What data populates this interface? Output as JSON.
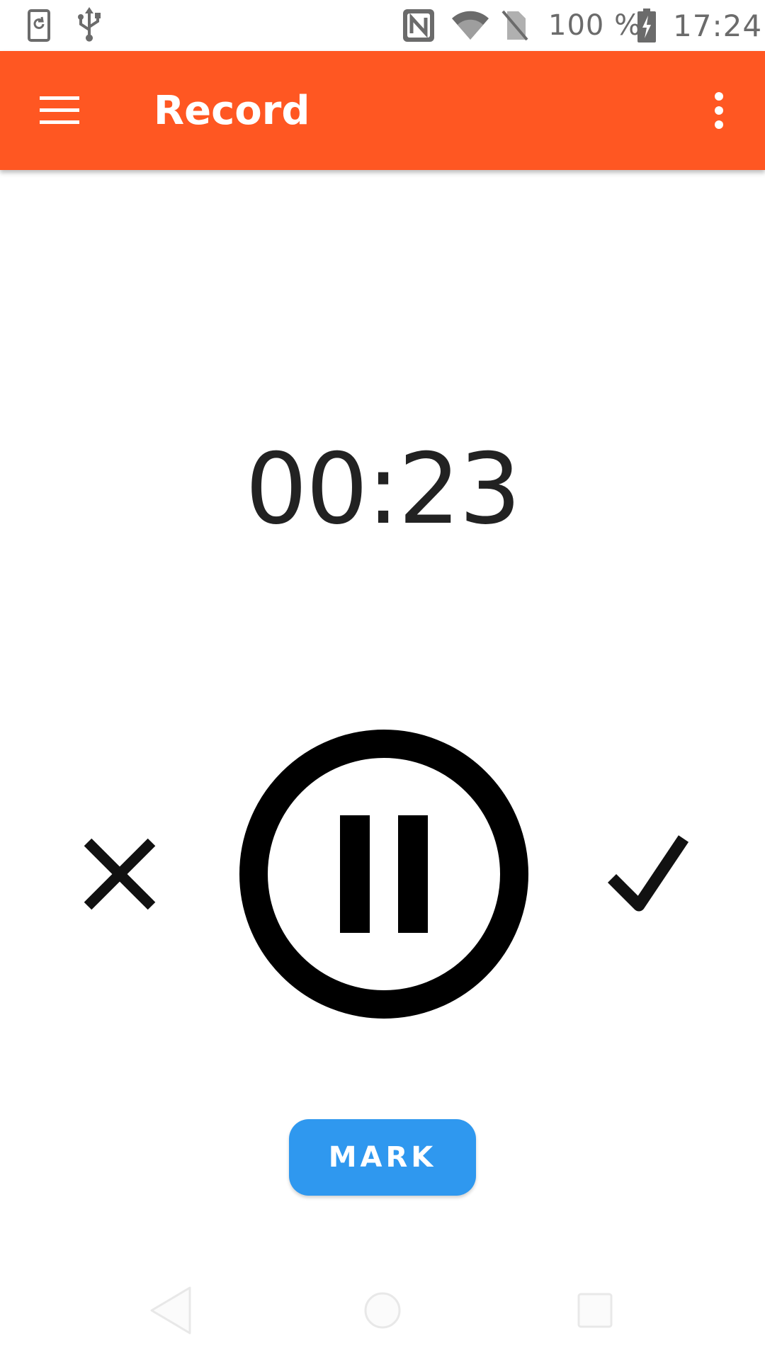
{
  "status_bar": {
    "battery_percent": "100 %",
    "time": "17:24",
    "icons": [
      "screen-rotate-icon",
      "usb-icon",
      "nfc-icon",
      "wifi-icon",
      "no-sim-icon",
      "battery-charging-icon"
    ]
  },
  "app_bar": {
    "title": "Record",
    "menu_icon": "hamburger-menu-icon",
    "more_icon": "more-vert-icon",
    "color": "#ff5722"
  },
  "timer": {
    "elapsed": "00:23"
  },
  "controls": {
    "discard_icon": "close-icon",
    "pause_icon": "pause-circle-icon",
    "confirm_icon": "check-icon",
    "mark_label": "MARK",
    "mark_color": "#2f98ef"
  },
  "nav_bar": {
    "icons": [
      "back-icon",
      "home-icon",
      "recents-icon"
    ]
  }
}
